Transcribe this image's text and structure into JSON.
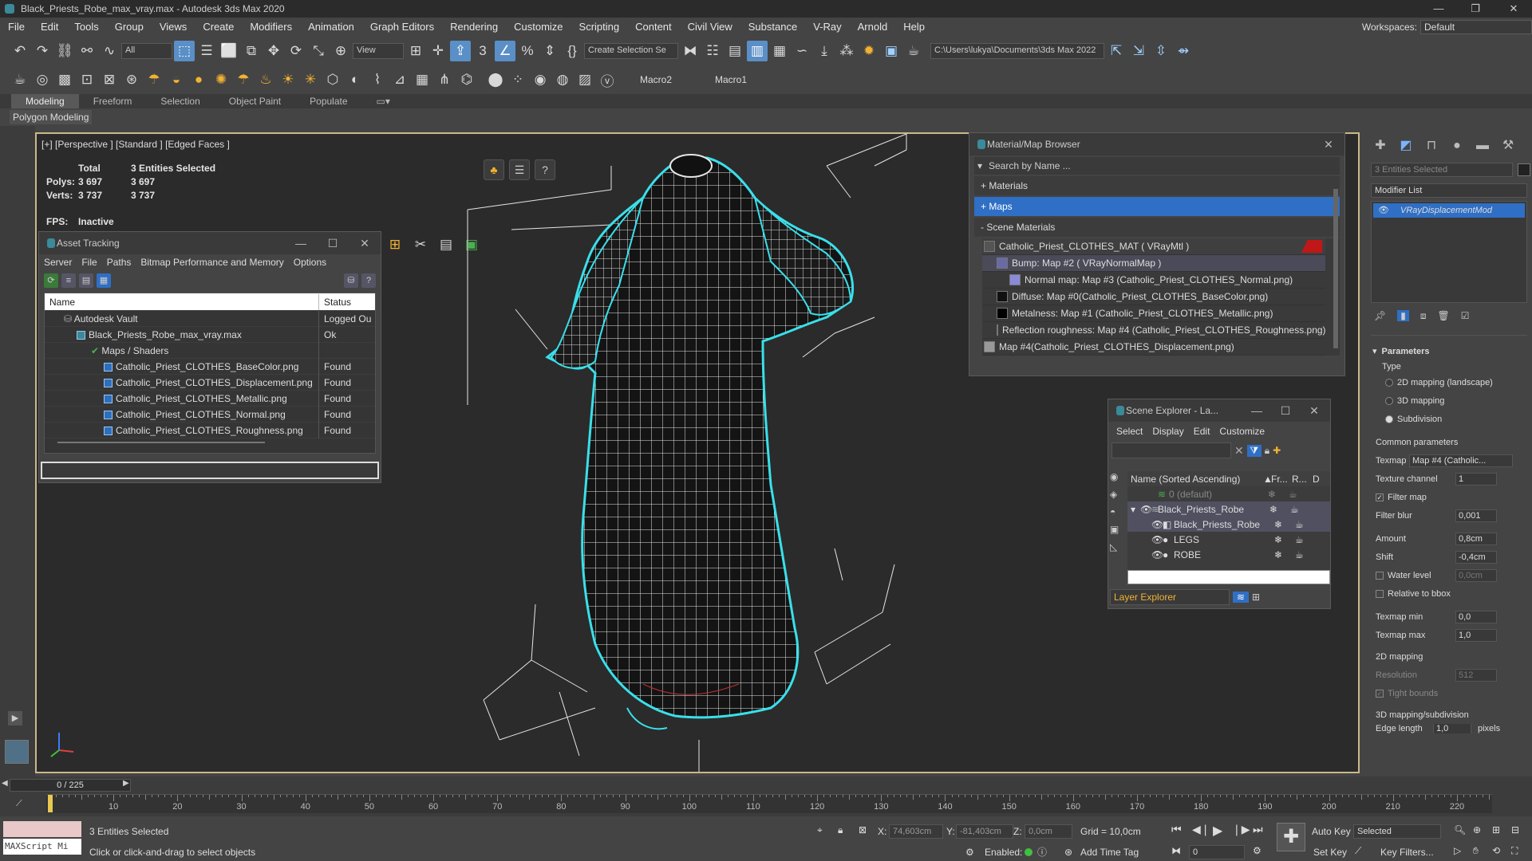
{
  "window": {
    "title": "Black_Priests_Robe_max_vray.max - Autodesk 3ds Max 2020"
  },
  "menu": [
    "File",
    "Edit",
    "Tools",
    "Group",
    "Views",
    "Create",
    "Modifiers",
    "Animation",
    "Graph Editors",
    "Rendering",
    "Customize",
    "Scripting",
    "Content",
    "Civil View",
    "Substance",
    "V-Ray",
    "Arnold",
    "Help"
  ],
  "workspaces": {
    "label": "Workspaces:",
    "value": "Default"
  },
  "toolbar": {
    "filter_value": "All",
    "view_value": "View",
    "selection_set": "Create Selection Se",
    "project_path": "C:\\Users\\lukya\\Documents\\3ds Max 2022",
    "macro2": "Macro2",
    "macro1": "Macro1"
  },
  "ribbon": {
    "tabs": [
      "Modeling",
      "Freeform",
      "Selection",
      "Object Paint",
      "Populate"
    ],
    "sub": "Polygon Modeling"
  },
  "viewport": {
    "label": "[+] [Perspective ] [Standard ] [Edged Faces ]",
    "stats": {
      "total_label": "Total",
      "selected_label": "3 Entities Selected",
      "polys_label": "Polys:",
      "polys_total": "3 697",
      "polys_sel": "3 697",
      "verts_label": "Verts:",
      "verts_total": "3 737",
      "verts_sel": "3 737",
      "fps_label": "FPS:",
      "fps_value": "Inactive"
    }
  },
  "asset_tracking": {
    "title": "Asset Tracking",
    "menu": [
      "Server",
      "File",
      "Paths",
      "Bitmap Performance and Memory",
      "Options"
    ],
    "headers": {
      "name": "Name",
      "status": "Status"
    },
    "rows": [
      {
        "name": "Autodesk Vault",
        "status": "Logged Ou",
        "indent": 0
      },
      {
        "name": "Black_Priests_Robe_max_vray.max",
        "status": "Ok",
        "indent": 1
      },
      {
        "name": "Maps / Shaders",
        "status": "",
        "indent": 2
      },
      {
        "name": "Catholic_Priest_CLOTHES_BaseColor.png",
        "status": "Found",
        "indent": 3
      },
      {
        "name": "Catholic_Priest_CLOTHES_Displacement.png",
        "status": "Found",
        "indent": 3
      },
      {
        "name": "Catholic_Priest_CLOTHES_Metallic.png",
        "status": "Found",
        "indent": 3
      },
      {
        "name": "Catholic_Priest_CLOTHES_Normal.png",
        "status": "Found",
        "indent": 3
      },
      {
        "name": "Catholic_Priest_CLOTHES_Roughness.png",
        "status": "Found",
        "indent": 3
      }
    ]
  },
  "material_browser": {
    "title": "Material/Map Browser",
    "search_placeholder": "Search by Name ...",
    "sections": [
      "+ Materials",
      "+ Maps",
      "- Scene Materials"
    ],
    "items": [
      {
        "label": "Catholic_Priest_CLOTHES_MAT  ( VRayMtl )",
        "indent": 0,
        "color": "#555555"
      },
      {
        "label": "Bump: Map #2  ( VRayNormalMap )",
        "indent": 1,
        "color": "#6a6aa8"
      },
      {
        "label": "Normal map: Map #3 (Catholic_Priest_CLOTHES_Normal.png)",
        "indent": 2,
        "color": "#8a8ad8"
      },
      {
        "label": "Diffuse: Map #0(Catholic_Priest_CLOTHES_BaseColor.png)",
        "indent": 1,
        "color": "#111111"
      },
      {
        "label": "Metalness: Map #1 (Catholic_Priest_CLOTHES_Metallic.png)",
        "indent": 1,
        "color": "#000000"
      },
      {
        "label": "Reflection roughness: Map #4 (Catholic_Priest_CLOTHES_Roughness.png)",
        "indent": 1,
        "color": "#bbbbbb"
      },
      {
        "label": "Map #4(Catholic_Priest_CLOTHES_Displacement.png)",
        "indent": 0,
        "color": "#999999"
      }
    ]
  },
  "scene_explorer": {
    "title": "Scene Explorer - La...",
    "menu": [
      "Select",
      "Display",
      "Edit",
      "Customize"
    ],
    "columns": {
      "name": "Name (Sorted Ascending)",
      "fr": "Fr...",
      "r": "R...",
      "d": "D"
    },
    "rows": [
      {
        "name": "0 (default)",
        "indent": 0,
        "dim": true
      },
      {
        "name": "Black_Priests_Robe",
        "indent": 0,
        "sel": true
      },
      {
        "name": "Black_Priests_Robe",
        "indent": 1,
        "sel": true
      },
      {
        "name": "LEGS",
        "indent": 1
      },
      {
        "name": "ROBE",
        "indent": 1
      }
    ],
    "footer": "Layer Explorer"
  },
  "command_panel": {
    "selection_field": "3 Entities Selected",
    "modifier_list": "Modifier List",
    "stack_item": "VRayDisplacementMod",
    "params_title": "Parameters",
    "type_label": "Type",
    "type_options": [
      "2D mapping (landscape)",
      "3D mapping",
      "Subdivision"
    ],
    "common": "Common parameters",
    "texmap_label": "Texmap",
    "texmap_value": "Map #4 (Catholic...",
    "texchannel_label": "Texture channel",
    "texchannel_value": "1",
    "filtermap": "Filter map",
    "filterblur_label": "Filter blur",
    "filterblur_value": "0,001",
    "amount_label": "Amount",
    "amount_value": "0,8cm",
    "shift_label": "Shift",
    "shift_value": "-0,4cm",
    "waterlevel_label": "Water level",
    "waterlevel_value": "0,0cm",
    "relbbox": "Relative to bbox",
    "texmin_label": "Texmap min",
    "texmin_value": "0,0",
    "texmax_label": "Texmap max",
    "texmax_value": "1,0",
    "map2d": "2D mapping",
    "resolution_label": "Resolution",
    "resolution_value": "512",
    "tightbounds": "Tight bounds",
    "map3d": "3D mapping/subdivision",
    "edge_label": "Edge length",
    "edge_value": "1,0",
    "edge_unit": "pixels"
  },
  "timeline": {
    "slider": "0 / 225",
    "ticks": [
      "10",
      "20",
      "30",
      "40",
      "50",
      "60",
      "70",
      "80",
      "90",
      "100",
      "110",
      "120",
      "130",
      "140",
      "150",
      "160",
      "170",
      "180",
      "190",
      "200",
      "210",
      "220"
    ]
  },
  "statusbar": {
    "maxscript": "MAXScript Mi",
    "selected": "3 Entities Selected",
    "prompt": "Click or click-and-drag to select objects",
    "x_label": "X:",
    "x_value": "74,603cm",
    "y_label": "Y:",
    "y_value": "-81,403cm",
    "z_label": "Z:",
    "z_value": "0,0cm",
    "grid": "Grid = 10,0cm",
    "enabled": "Enabled:",
    "addtimetag": "Add Time Tag",
    "autokey": "Auto Key",
    "setkey": "Set Key",
    "selected_dd": "Selected",
    "keyfilters": "Key Filters...",
    "frame": "0"
  }
}
